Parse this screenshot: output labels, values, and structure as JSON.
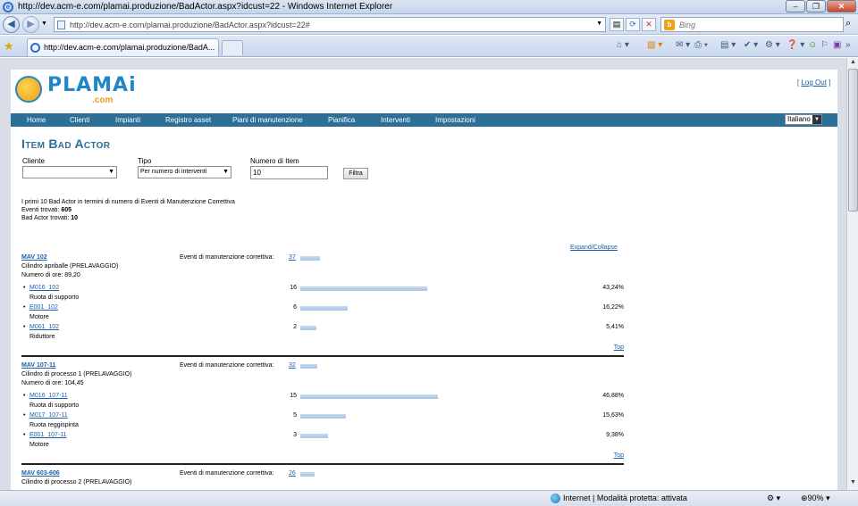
{
  "window": {
    "title": "http://dev.acm-e.com/plamai.produzione/BadActor.aspx?idcust=22 - Windows Internet Explorer"
  },
  "browser": {
    "url": "http://dev.acm-e.com/plamai.produzione/BadActor.aspx?idcust=22#",
    "search_placeholder": "Bing",
    "tab_title": "http://dev.acm-e.com/plamai.produzione/BadA...",
    "status": "Internet | Modalità protetta: attivata",
    "zoom": "90%"
  },
  "site": {
    "brand": "PLAMAi",
    "brand_sub": ".com",
    "logout": "Log Out",
    "menu": [
      "Home",
      "Clienti",
      "Impianti",
      "Registro asset",
      "Piani di manutenzione",
      "Pianifica",
      "Interventi",
      "Impostazioni"
    ],
    "language": "Italiano"
  },
  "page": {
    "title": "Item Bad Actor",
    "filters": {
      "cliente_label": "Cliente",
      "cliente_value": "",
      "tipo_label": "Tipo",
      "tipo_value": "Per numero di interventi",
      "numero_label": "Numero di Item",
      "numero_value": "10",
      "filtra_label": "Filtra"
    },
    "summary": {
      "line1": "I primi 10 Bad Actor in termini di numero di Eventi di Manutenzione Correttiva",
      "eventi_label": "Eventi trovati:",
      "eventi_value": "605",
      "bad_label": "Bad Actor trovati:",
      "bad_value": "10"
    },
    "expand_collapse": "Expand/Collapse",
    "events_label": "Eventi di manutenzione correttiva:",
    "top_label": "Top",
    "groups": [
      {
        "name": "MAV 102",
        "desc": "Cilindro apriballe (PRELAVAGGIO)",
        "hours": "Numero di ore: 89,20",
        "events": "37",
        "items": [
          {
            "code": "M016_102",
            "desc": "Ruota di supporto",
            "count": "16",
            "pct": "43,24%",
            "share": 0.4324
          },
          {
            "code": "E001_102",
            "desc": "Motore",
            "count": "6",
            "pct": "16,22%",
            "share": 0.1622
          },
          {
            "code": "M001_102",
            "desc": "Riduttore",
            "count": "2",
            "pct": "5,41%",
            "share": 0.0541
          }
        ]
      },
      {
        "name": "MAV 107-11",
        "desc": "Cilindro di processo 1 (PRELAVAGGIO)",
        "hours": "Numero di ore: 104,45",
        "events": "32",
        "items": [
          {
            "code": "M016_107-11",
            "desc": "Ruota di supporto",
            "count": "15",
            "pct": "46,88%",
            "share": 0.4688
          },
          {
            "code": "M017_107-11",
            "desc": "Ruota reggispinta",
            "count": "5",
            "pct": "15,63%",
            "share": 0.1563
          },
          {
            "code": "E001_107-11",
            "desc": "Motore",
            "count": "3",
            "pct": "9,38%",
            "share": 0.0938
          }
        ]
      },
      {
        "name": "MAV 603-606",
        "desc": "Cilindro di processo 2 (PRELAVAGGIO)",
        "hours": "",
        "events": "26",
        "items": []
      }
    ]
  }
}
